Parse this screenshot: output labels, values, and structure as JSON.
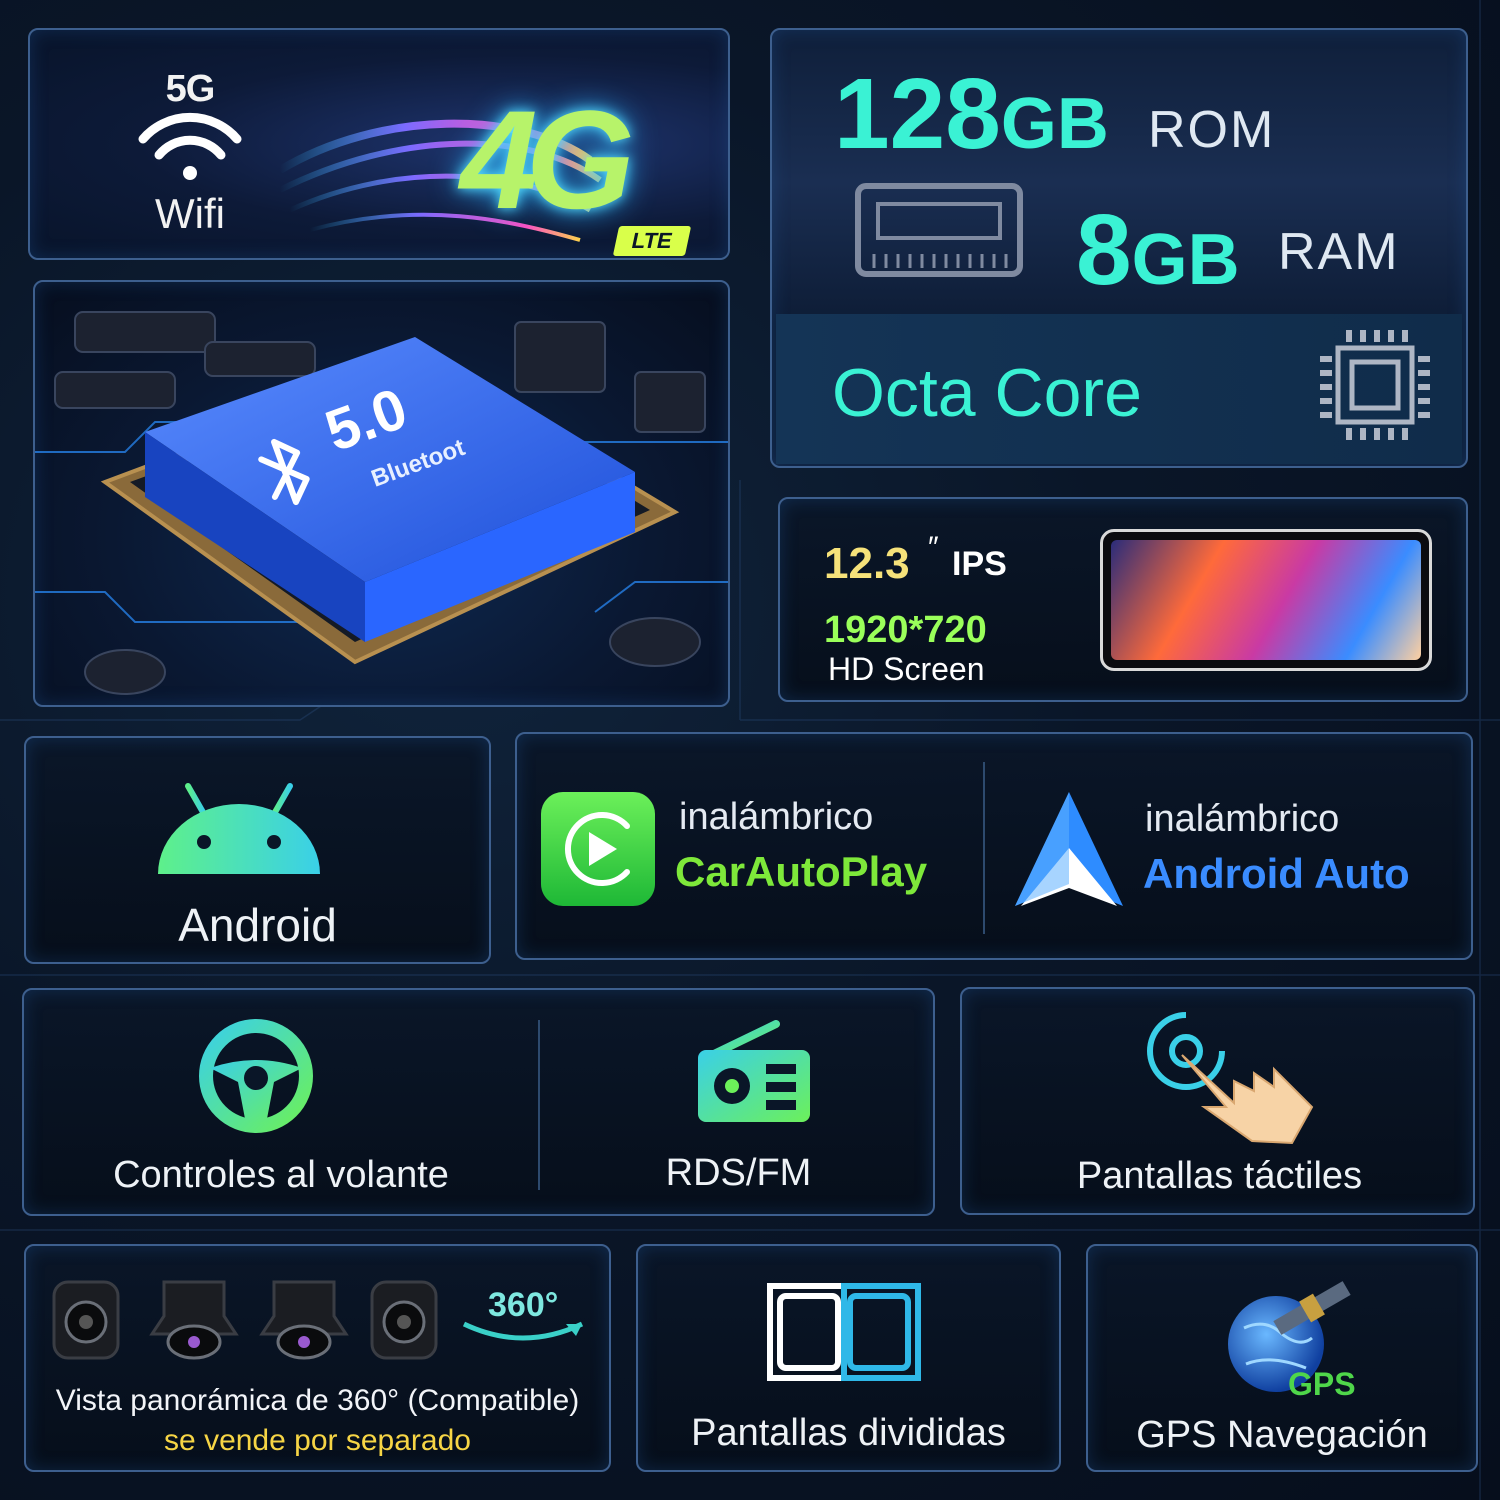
{
  "connectivity": {
    "wifi_5g": "5G",
    "wifi_label": "Wifi",
    "cellular": "4G",
    "cellular_badge": "LTE"
  },
  "memory": {
    "rom_value": "128",
    "rom_unit": "GB",
    "rom_label": "ROM",
    "ram_value": "8",
    "ram_unit": "GB",
    "ram_label": "RAM",
    "cpu_label": "Octa Core"
  },
  "bluetooth": {
    "version": "5.0",
    "label": "Bluetoot"
  },
  "screen": {
    "size": "12.3",
    "size_mark": "″",
    "panel_type": "IPS",
    "resolution": "1920*720",
    "hd_label": "HD Screen"
  },
  "android": {
    "label": "Android"
  },
  "carplay": {
    "sub": "inalámbrico",
    "name": "CarAutoPlay",
    "color": "#7ee83a"
  },
  "android_auto": {
    "sub": "inalámbrico",
    "name": "Android Auto",
    "color": "#3a8cff"
  },
  "features": {
    "steering": "Controles al volante",
    "radio": "RDS/FM",
    "touch": "Pantallas táctiles"
  },
  "bottom": {
    "panorama": "Vista panorámica de 360° (Compatible)",
    "panorama_note": "se vende por separado",
    "degrees": "360°",
    "split": "Pantallas divididas",
    "gps": "GPS Navegación",
    "gps_tag": "GPS"
  },
  "icons": [
    "wifi-icon",
    "ram-chip-icon",
    "cpu-icon",
    "bluetooth-chip-icon",
    "android-icon",
    "carplay-icon",
    "android-auto-icon",
    "steering-wheel-icon",
    "radio-icon",
    "touch-hand-icon",
    "camera-icon",
    "rotate-360-icon",
    "split-screen-icon",
    "gps-globe-icon"
  ]
}
